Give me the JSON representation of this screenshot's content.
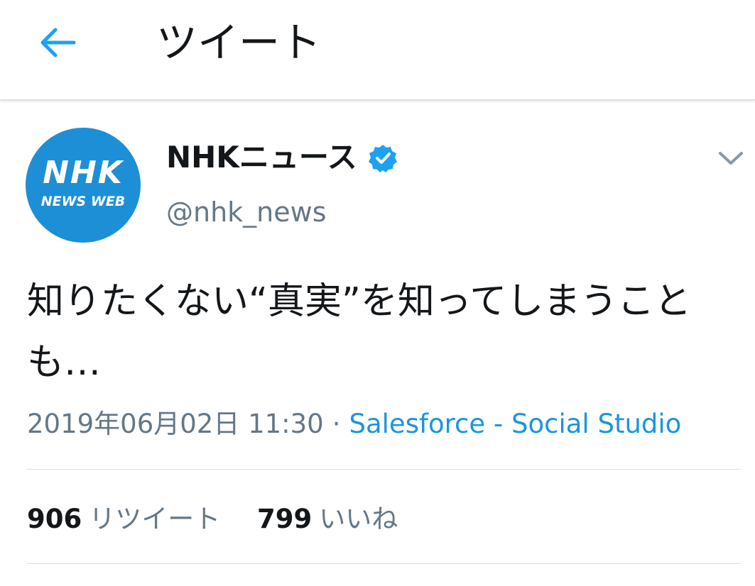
{
  "header": {
    "back_icon": "arrow-left-icon",
    "title": "ツイート"
  },
  "tweet": {
    "avatar": {
      "logo_main": "NHK",
      "logo_sub": "NEWS WEB"
    },
    "display_name": "NHKニュース",
    "verified_icon": "verified-badge-icon",
    "handle": "@nhk_news",
    "caret_icon": "chevron-down-icon",
    "text": "知りたくない“真実”を知ってしまうことも…",
    "timestamp": "2019年06月02日 11:30",
    "separator": "·",
    "source": "Salesforce - Social Studio",
    "retweets": {
      "count": "906",
      "label": "リツイート"
    },
    "likes": {
      "count": "799",
      "label": "いいね"
    }
  },
  "colors": {
    "accent": "#1da1f2",
    "link": "#1b95e0",
    "secondary_text": "#657786",
    "avatar_bg": "#1d8fd6"
  }
}
